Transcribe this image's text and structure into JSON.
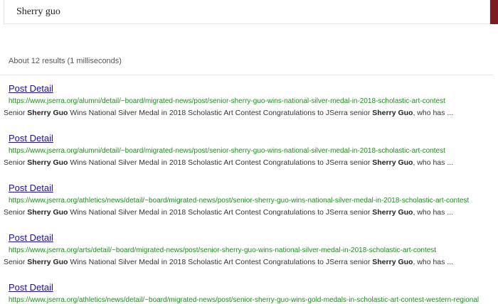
{
  "search": {
    "query": "Sherry guo",
    "accent_color": "#7a1a21"
  },
  "results_summary": "About 12 results (1 milliseconds)",
  "results": [
    {
      "title": "Post Detail",
      "url": "https://www.jserra.org/alumni/detail/~board/migrated-news/post/senior-sherry-guo-wins-national-silver-medal-in-2018-scholastic-art-contest",
      "snippet": [
        {
          "text": "Senior ",
          "bold": false
        },
        {
          "text": "Sherry Guo",
          "bold": true
        },
        {
          "text": " Wins National Silver Medal in 2018 Scholastic Art Contest Congratulations to JSerra senior ",
          "bold": false
        },
        {
          "text": "Sherry Guo",
          "bold": true
        },
        {
          "text": ", who has ...",
          "bold": false
        }
      ]
    },
    {
      "title": "Post Detail",
      "url": "https://www.jserra.org/alumni/detail/~board/migrated-news/post/senior-sherry-guo-wins-national-silver-medal-in-2018-scholastic-art-contest",
      "snippet": [
        {
          "text": "Senior ",
          "bold": false
        },
        {
          "text": "Sherry Guo",
          "bold": true
        },
        {
          "text": " Wins National Silver Medal in 2018 Scholastic Art Contest Congratulations to JSerra senior ",
          "bold": false
        },
        {
          "text": "Sherry Guo",
          "bold": true
        },
        {
          "text": ", who has ...",
          "bold": false
        }
      ]
    },
    {
      "title": "Post Detail",
      "url": "https://www.jserra.org/athletics/news/detail/~board/migrated-news/post/senior-sherry-guo-wins-national-silver-medal-in-2018-scholastic-art-contest",
      "snippet": [
        {
          "text": "Senior ",
          "bold": false
        },
        {
          "text": "Sherry Guo",
          "bold": true
        },
        {
          "text": " Wins National Silver Medal in 2018 Scholastic Art Contest Congratulations to JSerra senior ",
          "bold": false
        },
        {
          "text": "Sherry Guo",
          "bold": true
        },
        {
          "text": ", who has ...",
          "bold": false
        }
      ]
    },
    {
      "title": "Post Detail",
      "url": "https://www.jserra.org/arts/detail/~board/migrated-news/post/senior-sherry-guo-wins-national-silver-medal-in-2018-scholastic-art-contest",
      "snippet": [
        {
          "text": "Senior ",
          "bold": false
        },
        {
          "text": "Sherry Guo",
          "bold": true
        },
        {
          "text": " Wins National Silver Medal in 2018 Scholastic Art Contest Congratulations to JSerra senior ",
          "bold": false
        },
        {
          "text": "Sherry Guo",
          "bold": true
        },
        {
          "text": ", who has ...",
          "bold": false
        }
      ]
    },
    {
      "title": "Post Detail",
      "url": "https://www.jserra.org/athletics/news/detail/~board/migrated-news/post/senior-sherry-guo-wins-gold-medals-in-scholastic-art-contest-western-regional",
      "snippet": []
    }
  ]
}
